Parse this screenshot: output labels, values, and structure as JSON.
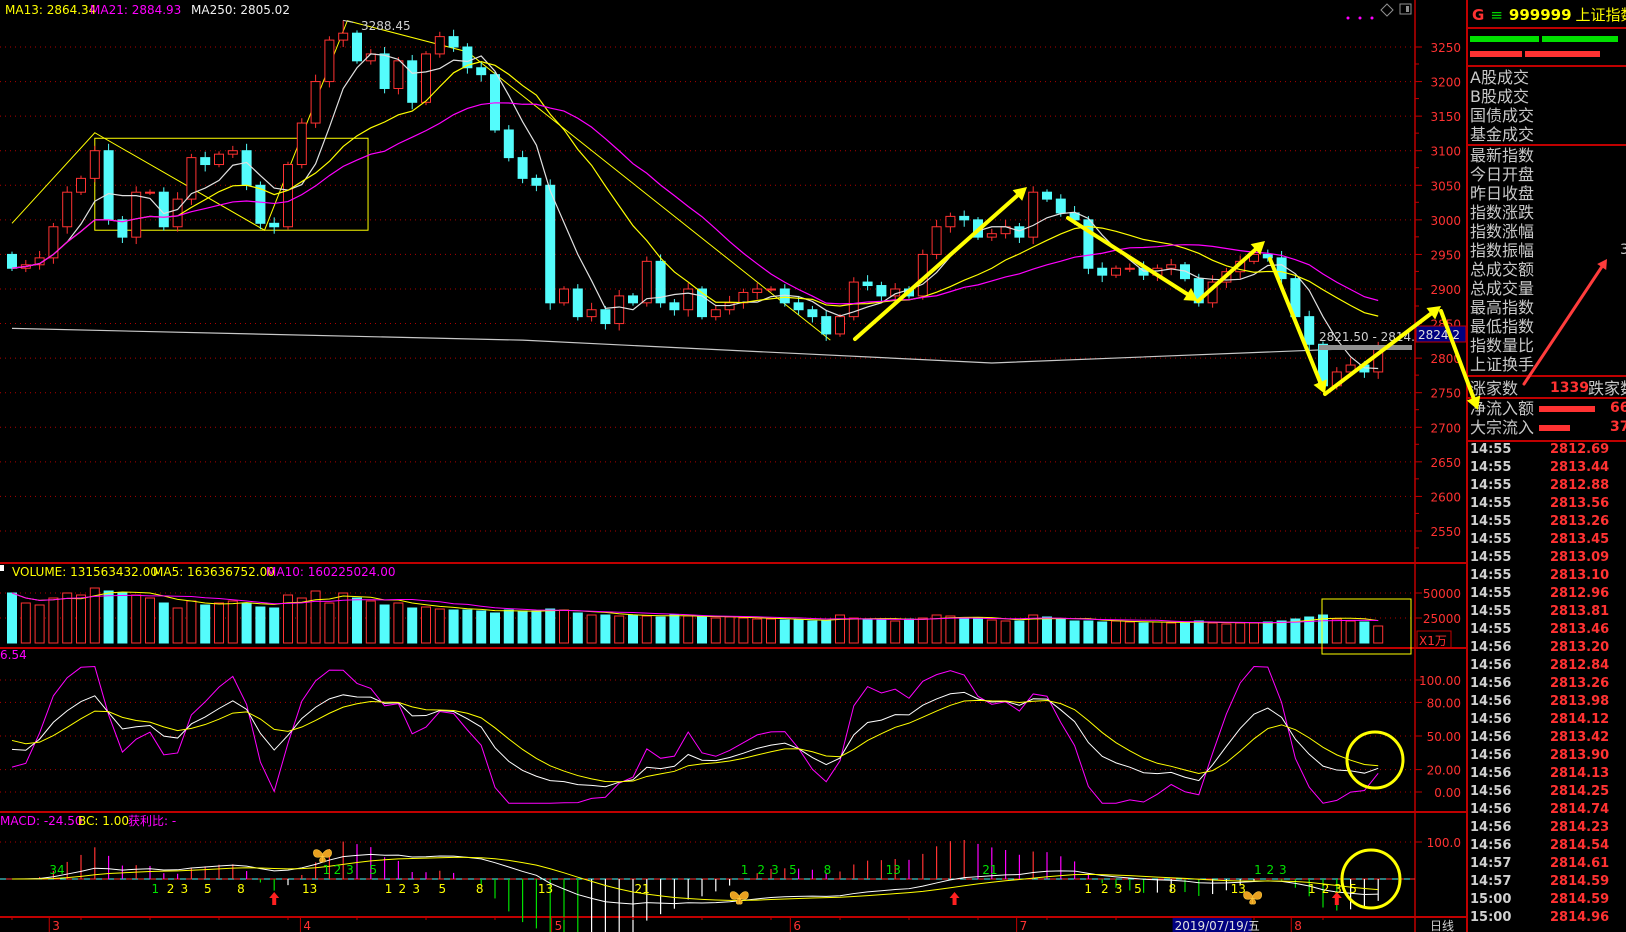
{
  "header": {
    "ma13": "MA13: 2864.34",
    "ma21": "MA21: 2884.93",
    "ma250": "MA250: 2805.02",
    "peak_label": "3288.45",
    "range_label": "2821.50 - 2814.96",
    "current_price": "2824.2"
  },
  "volume_header": {
    "volume": "VOLUME: 131563432.00",
    "ma5": "MA5: 163636752.00",
    "ma10": "MA10: 160225024.00",
    "unit": "X1万"
  },
  "kdj_header": {
    "value": "6.54"
  },
  "macd_header": {
    "macd": "MACD: -24.50",
    "bc": "BC: 1.00",
    "profit": "获利比: -"
  },
  "axis": {
    "period": "日线",
    "cursor_date": "2019/07/19/五",
    "cursor_index": 87,
    "months": [
      {
        "label": "3",
        "index": 2.7
      },
      {
        "label": "4",
        "index": 20.9
      },
      {
        "label": "5",
        "index": 39.1
      },
      {
        "label": "6",
        "index": 56.4
      },
      {
        "label": "7",
        "index": 72.8
      },
      {
        "label": "8",
        "index": 92.7
      }
    ],
    "price_ticks": [
      "3250",
      "3200",
      "3150",
      "3100",
      "3050",
      "3000",
      "2950",
      "2900",
      "2850",
      "2800",
      "2750",
      "2700",
      "2650",
      "2600",
      "2550"
    ],
    "volume_ticks": [
      "50000",
      "25000"
    ],
    "kdj_ticks": [
      "100.00",
      "80.00",
      "50.00",
      "20.00",
      "0.00"
    ],
    "macd_ticks": [
      "100.0"
    ]
  },
  "chart_data": {
    "type": "candlestick",
    "title": "999999 上证指数 日线",
    "open0": 2950,
    "peak": {
      "index": 24,
      "value": 3288.45
    },
    "close": [
      2930,
      2935,
      2945,
      2990,
      3040,
      3060,
      3100,
      3000,
      2975,
      3040,
      3040,
      2990,
      3030,
      3090,
      3080,
      3095,
      3100,
      3050,
      2995,
      2990,
      3080,
      3140,
      3200,
      3260,
      3270,
      3230,
      3240,
      3190,
      3230,
      3170,
      3240,
      3265,
      3250,
      3220,
      3210,
      3130,
      3090,
      3060,
      3050,
      2880,
      2900,
      2860,
      2870,
      2850,
      2890,
      2880,
      2940,
      2880,
      2870,
      2900,
      2860,
      2870,
      2880,
      2895,
      2900,
      2900,
      2880,
      2870,
      2860,
      2835,
      2860,
      2910,
      2905,
      2890,
      2900,
      2890,
      2950,
      2990,
      3005,
      3000,
      2975,
      2980,
      2990,
      2975,
      3040,
      3030,
      3010,
      3000,
      2930,
      2920,
      2930,
      2930,
      2920,
      2930,
      2935,
      2915,
      2880,
      2910,
      2925,
      2940,
      2950,
      2945,
      2915,
      2860,
      2820,
      2760,
      2780,
      2790,
      2780,
      2815
    ],
    "volume": [
      50000,
      40000,
      38000,
      45000,
      50000,
      48000,
      55000,
      52000,
      50000,
      48000,
      45000,
      40000,
      35000,
      42000,
      38000,
      40000,
      42000,
      40000,
      36000,
      35000,
      48000,
      45000,
      52000,
      40000,
      50000,
      45000,
      42000,
      38000,
      40000,
      35000,
      36000,
      34000,
      33000,
      33000,
      32000,
      30000,
      33000,
      32000,
      32000,
      34000,
      33000,
      30000,
      28000,
      28000,
      27000,
      28000,
      27000,
      26000,
      28000,
      27000,
      26000,
      25000,
      26000,
      25000,
      24000,
      24000,
      23000,
      23000,
      22000,
      22000,
      28000,
      25000,
      24000,
      23000,
      22000,
      24000,
      25000,
      28000,
      27000,
      24000,
      25000,
      23000,
      22000,
      22000,
      28000,
      26000,
      24000,
      22000,
      22000,
      21000,
      22000,
      21000,
      20000,
      21000,
      20000,
      21000,
      22000,
      20000,
      19000,
      20000,
      20000,
      21000,
      22000,
      24000,
      26000,
      28000,
      24000,
      22000,
      21000,
      17000
    ],
    "ma250_points": [
      {
        "index": 0,
        "value": 2843
      },
      {
        "index": 37,
        "value": 2826
      },
      {
        "index": 71,
        "value": 2793
      },
      {
        "index": 100,
        "value": 2816
      }
    ],
    "trend_line": [
      {
        "index": 0,
        "value": 2995
      },
      {
        "index": 6,
        "value": 3126
      },
      {
        "index": 18.3,
        "value": 2985
      },
      {
        "index": 24.3,
        "value": 3288
      },
      {
        "index": 33,
        "value": 3243
      },
      {
        "index": 59.3,
        "value": 2826
      }
    ],
    "box": {
      "index_from": 6,
      "index_to": 25.8,
      "high": 3118,
      "low": 2985
    },
    "ylim": [
      2525,
      3318
    ],
    "macd_marks": [
      {
        "text": "34",
        "index": 3,
        "color": "#00e000",
        "pos": "above"
      },
      {
        "text": "1",
        "index": 10.4,
        "color": "#00e000",
        "pos": "below"
      },
      {
        "text": "2",
        "index": 11.5,
        "color": "#ffff00",
        "pos": "below"
      },
      {
        "text": "3",
        "index": 12.5,
        "color": "#ffff00",
        "pos": "below"
      },
      {
        "text": "5",
        "index": 14.2,
        "color": "#ffff00",
        "pos": "below"
      },
      {
        "text": "8",
        "index": 16.6,
        "color": "#ffff00",
        "pos": "below"
      },
      {
        "text": "13",
        "index": 21.3,
        "color": "#ffff00",
        "pos": "below"
      },
      {
        "text": "1",
        "index": 22.8,
        "color": "#00e000",
        "pos": "above"
      },
      {
        "text": "2",
        "index": 23.6,
        "color": "#00e000",
        "pos": "above"
      },
      {
        "text": "3",
        "index": 24.5,
        "color": "#00e000",
        "pos": "above"
      },
      {
        "text": "5",
        "index": 26.2,
        "color": "#00e000",
        "pos": "above"
      },
      {
        "text": "1",
        "index": 27.3,
        "color": "#ffff00",
        "pos": "below"
      },
      {
        "text": "2",
        "index": 28.3,
        "color": "#ffff00",
        "pos": "below"
      },
      {
        "text": "3",
        "index": 29.3,
        "color": "#ffff00",
        "pos": "below"
      },
      {
        "text": "5",
        "index": 31.2,
        "color": "#ffff00",
        "pos": "below"
      },
      {
        "text": "8",
        "index": 33.9,
        "color": "#ffff00",
        "pos": "below"
      },
      {
        "text": "13",
        "index": 38.4,
        "color": "#ffff00",
        "pos": "below"
      },
      {
        "text": "21",
        "index": 45.4,
        "color": "#ffff00",
        "pos": "below"
      },
      {
        "text": "1",
        "index": 53.1,
        "color": "#00e000",
        "pos": "above"
      },
      {
        "text": "2",
        "index": 54.3,
        "color": "#00e000",
        "pos": "above"
      },
      {
        "text": "3",
        "index": 55.3,
        "color": "#00e000",
        "pos": "above"
      },
      {
        "text": "5",
        "index": 56.6,
        "color": "#00e000",
        "pos": "above"
      },
      {
        "text": "8",
        "index": 59.1,
        "color": "#00e000",
        "pos": "above"
      },
      {
        "text": "13",
        "index": 63.6,
        "color": "#00e000",
        "pos": "above"
      },
      {
        "text": "21",
        "index": 70.6,
        "color": "#00e000",
        "pos": "above"
      },
      {
        "text": "1",
        "index": 78,
        "color": "#ffff00",
        "pos": "below"
      },
      {
        "text": "2",
        "index": 79.2,
        "color": "#ffff00",
        "pos": "below"
      },
      {
        "text": "3",
        "index": 80.2,
        "color": "#ffff00",
        "pos": "below"
      },
      {
        "text": "5",
        "index": 81.6,
        "color": "#ffff00",
        "pos": "below"
      },
      {
        "text": "8",
        "index": 84.1,
        "color": "#ffff00",
        "pos": "below"
      },
      {
        "text": "13",
        "index": 88.6,
        "color": "#ffff00",
        "pos": "below"
      },
      {
        "text": "1",
        "index": 90.3,
        "color": "#00e000",
        "pos": "above"
      },
      {
        "text": "2",
        "index": 91.2,
        "color": "#00e000",
        "pos": "above"
      },
      {
        "text": "3",
        "index": 92.1,
        "color": "#00e000",
        "pos": "above"
      },
      {
        "text": "1",
        "index": 94.2,
        "color": "#ffff00",
        "pos": "below"
      },
      {
        "text": "2",
        "index": 95.2,
        "color": "#ffff00",
        "pos": "below"
      },
      {
        "text": "3",
        "index": 96.1,
        "color": "#ffff00",
        "pos": "below"
      },
      {
        "text": "5",
        "index": 97.2,
        "color": "#ffff00",
        "pos": "below"
      }
    ],
    "buy_arrows": [
      19,
      68.3,
      96
    ],
    "butterflies": [
      {
        "index": 22.5,
        "pos": "above"
      },
      {
        "index": 52.7,
        "pos": "below"
      },
      {
        "index": 89.9,
        "pos": "below"
      }
    ]
  },
  "right_panel": {
    "title": {
      "g": "G",
      "icon": "≡",
      "code": "999999",
      "name": "上证指数"
    },
    "section1": [
      "A股成交",
      "B股成交",
      "国债成交",
      "基金成交"
    ],
    "section2": [
      "最新指数",
      "今日开盘",
      "昨日收盘",
      "指数涨跌",
      "指数涨幅",
      "指数振幅",
      "总成交额",
      "总成交量",
      "最高指数",
      "最低指数",
      "指数量比",
      "上证换手"
    ],
    "amplitude_value": "3",
    "rise": {
      "label": "涨家数",
      "value": "1339",
      "label2": "跌家数"
    },
    "flows": [
      {
        "label": "净流入额",
        "value": "66.",
        "bar": 0.62
      },
      {
        "label": "大宗流入",
        "value": "37.",
        "bar": 0.34
      }
    ],
    "ticks": [
      {
        "time": "14:55",
        "price": "2812.69"
      },
      {
        "time": "14:55",
        "price": "2813.44"
      },
      {
        "time": "14:55",
        "price": "2812.88"
      },
      {
        "time": "14:55",
        "price": "2813.56"
      },
      {
        "time": "14:55",
        "price": "2813.26"
      },
      {
        "time": "14:55",
        "price": "2813.45"
      },
      {
        "time": "14:55",
        "price": "2813.09"
      },
      {
        "time": "14:55",
        "price": "2813.10"
      },
      {
        "time": "14:55",
        "price": "2812.96"
      },
      {
        "time": "14:55",
        "price": "2813.81"
      },
      {
        "time": "14:55",
        "price": "2813.46"
      },
      {
        "time": "14:56",
        "price": "2813.20"
      },
      {
        "time": "14:56",
        "price": "2812.84"
      },
      {
        "time": "14:56",
        "price": "2813.26"
      },
      {
        "time": "14:56",
        "price": "2813.98"
      },
      {
        "time": "14:56",
        "price": "2814.12"
      },
      {
        "time": "14:56",
        "price": "2813.42"
      },
      {
        "time": "14:56",
        "price": "2813.90"
      },
      {
        "time": "14:56",
        "price": "2814.13"
      },
      {
        "time": "14:56",
        "price": "2814.25"
      },
      {
        "time": "14:56",
        "price": "2814.74"
      },
      {
        "time": "14:56",
        "price": "2814.23"
      },
      {
        "time": "14:56",
        "price": "2814.54"
      },
      {
        "time": "14:57",
        "price": "2814.61"
      },
      {
        "time": "14:57",
        "price": "2814.59"
      },
      {
        "time": "15:00",
        "price": "2814.59"
      },
      {
        "time": "15:00",
        "price": "2814.96"
      }
    ]
  },
  "colors": {
    "up": "#ff3232",
    "down": "#54fcfc",
    "ma5": "#e0e0e0",
    "ma13": "#ffff00",
    "ma21": "#ff00ff",
    "grid": "#c00000",
    "annotation": "#ffff00",
    "annotation_red": "#ff3c3c"
  }
}
